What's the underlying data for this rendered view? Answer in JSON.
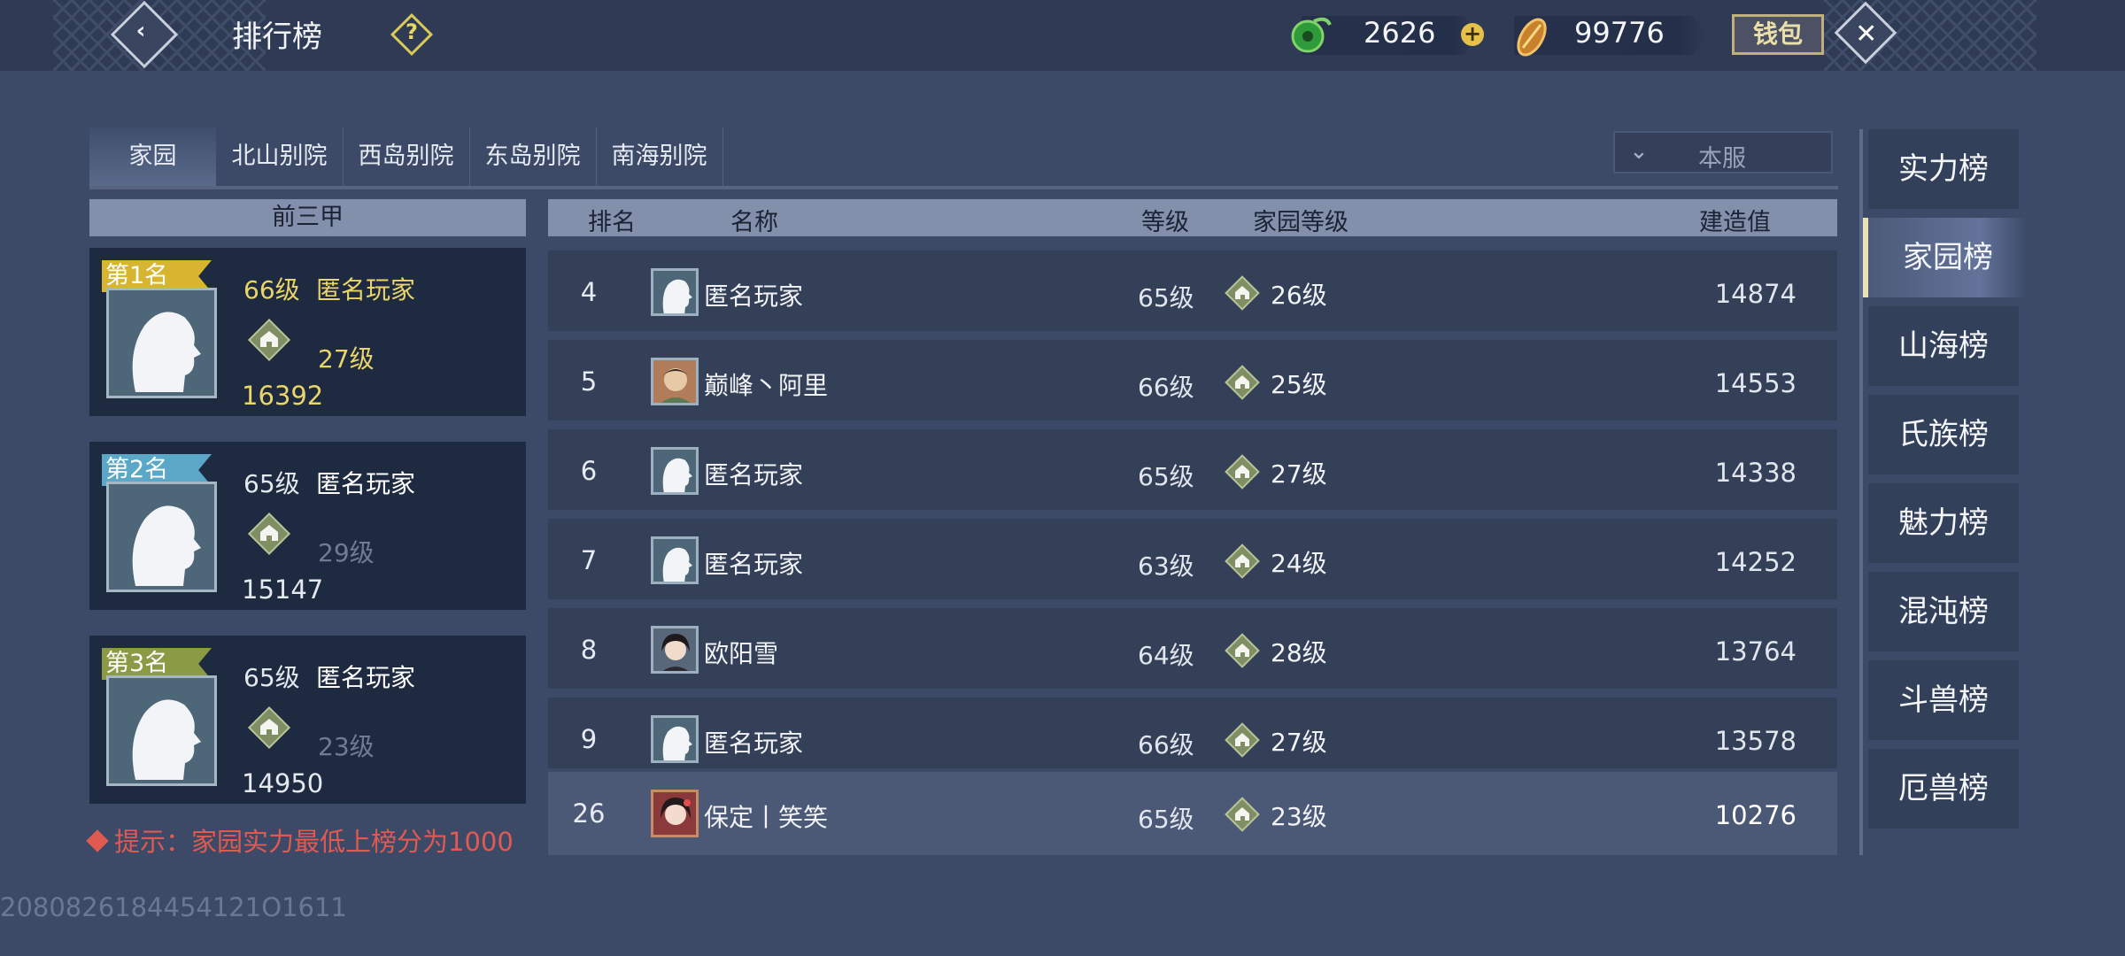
{
  "header": {
    "title": "排行榜",
    "help_icon": "question-icon",
    "currencies": [
      {
        "name": "jade",
        "icon": "jade-coin-icon",
        "value": "2626"
      },
      {
        "name": "gold",
        "icon": "gold-ingot-icon",
        "value": "99776"
      }
    ],
    "wallet_label": "钱包"
  },
  "tabs": [
    "家园",
    "北山别院",
    "西岛别院",
    "东岛别院",
    "南海别院"
  ],
  "active_tab": "家园",
  "server_select": {
    "value": "本服"
  },
  "top3": {
    "heading": "前三甲",
    "entries": [
      {
        "badge": "第1名",
        "level": "66级",
        "name": "匿名玩家",
        "home_level": "27级",
        "score": "16392",
        "badge_color": "#d7b530"
      },
      {
        "badge": "第2名",
        "level": "65级",
        "name": "匿名玩家",
        "home_level": "29级",
        "score": "15147",
        "badge_color": "#5aa7c8"
      },
      {
        "badge": "第3名",
        "level": "65级",
        "name": "匿名玩家",
        "home_level": "23级",
        "score": "14950",
        "badge_color": "#8b9a45"
      }
    ]
  },
  "tip": "提示：家园实力最低上榜分为1000",
  "table": {
    "headers": {
      "rank": "排名",
      "name": "名称",
      "level": "等级",
      "home_level": "家园等级",
      "score": "建造值"
    },
    "rows": [
      {
        "rank": "4",
        "name": "匿名玩家",
        "level": "65级",
        "home_level": "26级",
        "score": "14874",
        "avatar": "anonymous"
      },
      {
        "rank": "5",
        "name": "巅峰丶阿里",
        "level": "66级",
        "home_level": "25级",
        "score": "14553",
        "avatar": "portrait"
      },
      {
        "rank": "6",
        "name": "匿名玩家",
        "level": "65级",
        "home_level": "27级",
        "score": "14338",
        "avatar": "anonymous"
      },
      {
        "rank": "7",
        "name": "匿名玩家",
        "level": "63级",
        "home_level": "24级",
        "score": "14252",
        "avatar": "anonymous"
      },
      {
        "rank": "8",
        "name": "欧阳雪",
        "level": "64级",
        "home_level": "28级",
        "score": "13764",
        "avatar": "portrait"
      },
      {
        "rank": "9",
        "name": "匿名玩家",
        "level": "66级",
        "home_level": "27级",
        "score": "13578",
        "avatar": "anonymous"
      }
    ],
    "self_row": {
      "rank": "26",
      "name": "保定丨笑笑",
      "level": "65级",
      "home_level": "23级",
      "score": "10276",
      "avatar": "portrait"
    }
  },
  "side_menu": [
    "实力榜",
    "家园榜",
    "山海榜",
    "氏族榜",
    "魅力榜",
    "混沌榜",
    "斗兽榜",
    "厄兽榜"
  ],
  "side_menu_active": "家园榜",
  "build_id": "2080826184454121O1611"
}
